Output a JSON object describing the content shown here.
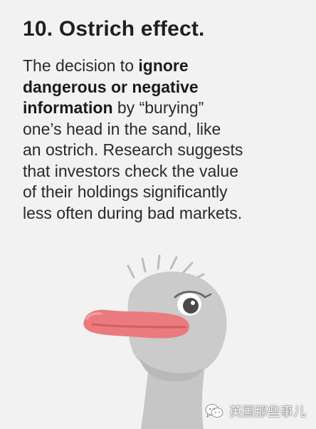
{
  "title": "10. Ostrich effect.",
  "body": {
    "lines": [
      {
        "pre": "The decision to ",
        "bold": "ignore",
        "post": ""
      },
      {
        "pre": "",
        "bold": "dangerous or negative",
        "post": ""
      },
      {
        "pre": "",
        "bold": "information",
        "post": " by “burying”"
      },
      {
        "pre": "one’s head in the sand, like",
        "bold": "",
        "post": ""
      },
      {
        "pre": "an ostrich. Research suggests",
        "bold": "",
        "post": ""
      },
      {
        "pre": "that investors check the value",
        "bold": "",
        "post": ""
      },
      {
        "pre": "of their holdings significantly",
        "bold": "",
        "post": ""
      },
      {
        "pre": "less often during bad markets.",
        "bold": "",
        "post": ""
      }
    ]
  },
  "illustration": {
    "icon": "ostrich-head-icon",
    "colors": {
      "head": "#c9c9c9",
      "beak": "#e9797d",
      "eye": "#4a4a4a"
    }
  },
  "watermark": {
    "icon": "wechat-icon",
    "text": "英国那些事儿"
  }
}
